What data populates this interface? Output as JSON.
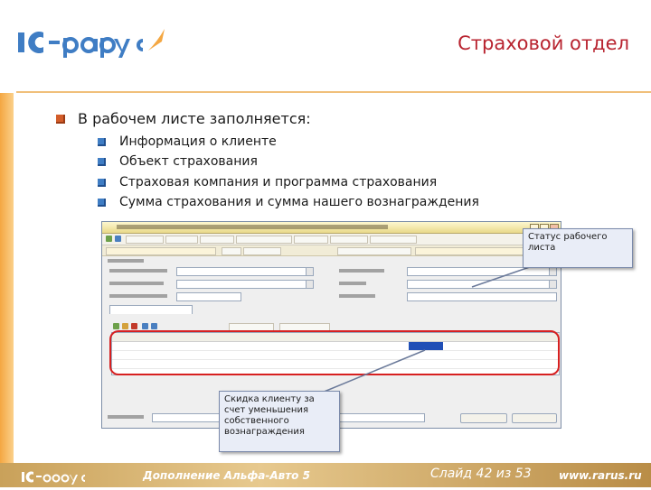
{
  "header": {
    "logo_text": "1С-рарус",
    "slide_title": "Страховой отдел"
  },
  "content": {
    "main_bullet": "В рабочем листе заполняется:",
    "sub_bullets": [
      "Информация о клиенте",
      "Объект страхования",
      "Страховая компания и программа страхования",
      "Сумма страхования и сумма нашего вознаграждения"
    ]
  },
  "callouts": {
    "status": "Статус рабочего листа",
    "discount": "Скидка клиенту за счет уменьшения собственного вознаграждения"
  },
  "footer": {
    "logo_text": "1С-рарус",
    "title": "Дополнение Альфа-Авто 5",
    "slide_number": "Слайд 42 из 53",
    "url": "www.rarus.ru"
  },
  "colors": {
    "title_red": "#b8232f",
    "bullet_orange": "#d35d2a",
    "bullet_blue": "#3f7dc4",
    "highlight_oval": "#d72020",
    "footer_band": "#c9a15a"
  }
}
